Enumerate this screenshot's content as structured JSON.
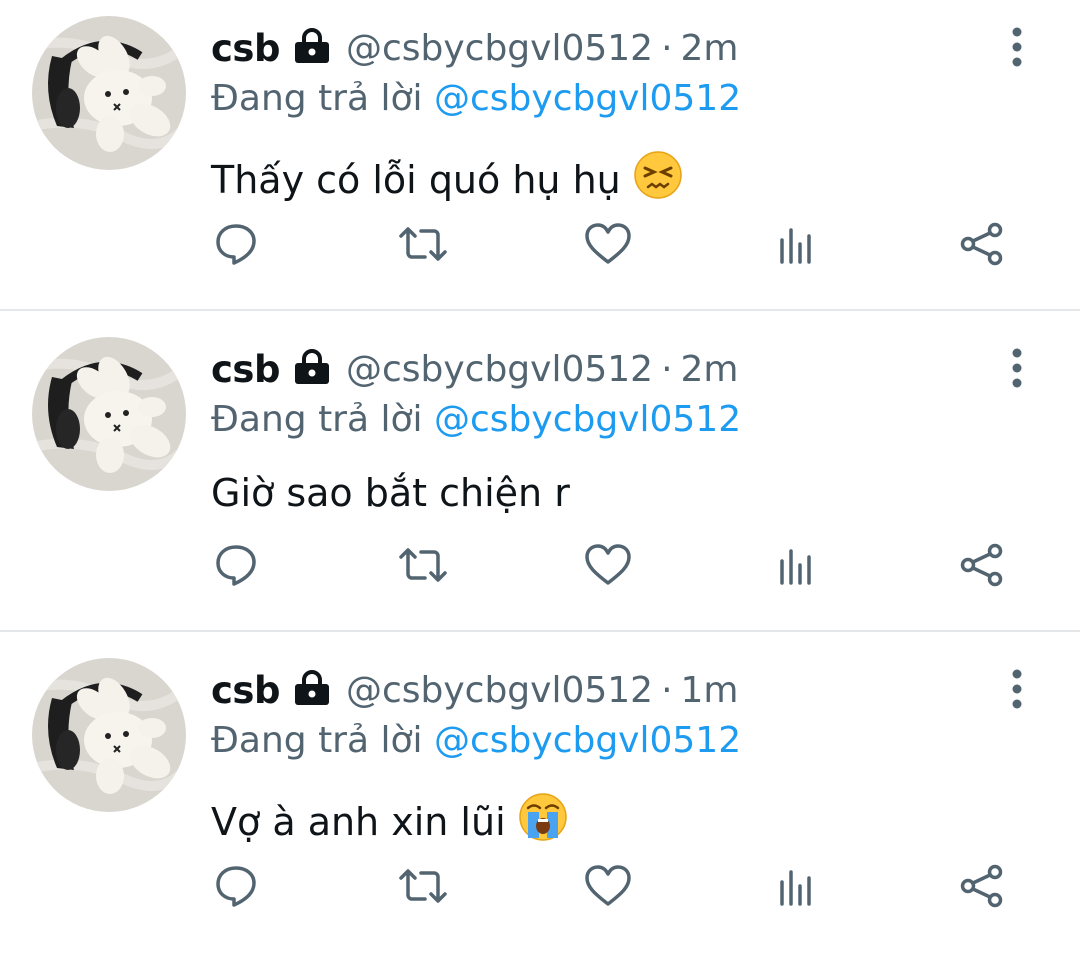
{
  "colors": {
    "text": "#0f1419",
    "secondary": "#536471",
    "link": "#1d9bf0",
    "separator": "#e3e7ea"
  },
  "icons": {
    "reply": "speech-bubble-icon",
    "retweet": "retweet-icon",
    "like": "heart-icon",
    "views": "bar-chart-icon",
    "share": "share-icon",
    "more": "vertical-ellipsis-icon",
    "locked": "lock-icon"
  },
  "tweets": [
    {
      "name": "csb",
      "handle": "@csbycbgvl0512",
      "dot": "·",
      "time": "2m",
      "reply_label": "Đang trả lời",
      "reply_mention": "@csbycbgvl0512",
      "text": "Thấy có lỗi quó hụ hụ",
      "emoji": "persevering-face"
    },
    {
      "name": "csb",
      "handle": "@csbycbgvl0512",
      "dot": "·",
      "time": "2m",
      "reply_label": "Đang trả lời",
      "reply_mention": "@csbycbgvl0512",
      "text": "Giờ sao bắt chiện r",
      "emoji": ""
    },
    {
      "name": "csb",
      "handle": "@csbycbgvl0512",
      "dot": "·",
      "time": "1m",
      "reply_label": "Đang trả lời",
      "reply_mention": "@csbycbgvl0512",
      "text": "Vợ à anh xin lũi",
      "emoji": "loudly-crying-face"
    }
  ]
}
